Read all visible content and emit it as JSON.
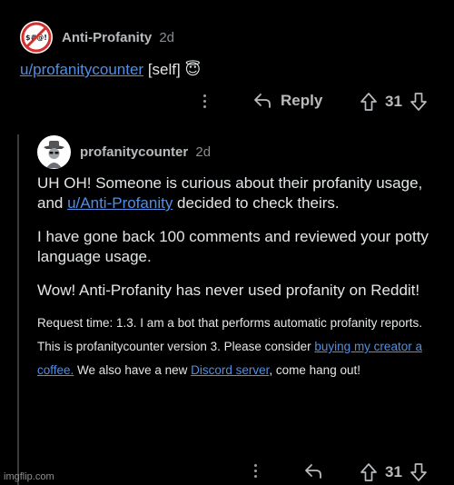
{
  "parent": {
    "author": "Anti-Profanity",
    "age": "2d",
    "avatar_icon": "no-profanity-sign-icon",
    "body_link": "u/profanitycounter",
    "body_rest": " [self] ",
    "emoji": "😇",
    "reply_label": "Reply",
    "votes": "31"
  },
  "reply": {
    "author": "profanitycounter",
    "age": "2d",
    "avatar_icon": "bot-cowboy-avatar-icon",
    "p1_a": "UH OH! Someone is curious about their profanity usage, and ",
    "p1_link": "u/Anti-Profanity",
    "p1_b": " decided to check theirs.",
    "p2": "I have gone back 100 comments and reviewed your potty language usage.",
    "p3": "Wow! Anti-Profanity has never used profanity on Reddit!",
    "p4_a": "Request time: 1.3. I am a bot that performs automatic profanity reports. This is profanitycounter version 3. Please consider ",
    "p4_link1": "buying my creator a coffee.",
    "p4_b": " We also have a new ",
    "p4_link2": "Discord server",
    "p4_c": ", come hang out!",
    "votes": "31"
  },
  "watermark": "imgflip.com",
  "colors": {
    "link": "#4f8fe6",
    "background": "#000000",
    "text": "#d7dadc"
  }
}
